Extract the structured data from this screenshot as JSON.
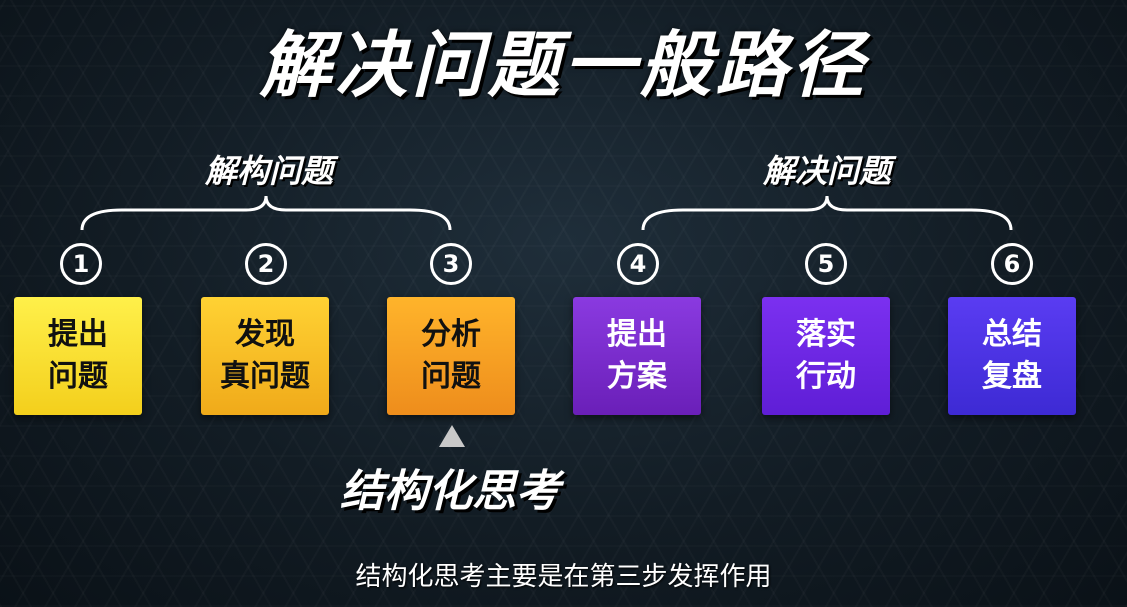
{
  "title": "解决问题一般路径",
  "groups": [
    {
      "label": "解构问题"
    },
    {
      "label": "解决问题"
    }
  ],
  "steps": [
    {
      "number": "1",
      "label": "提出\n问题",
      "color": "#f7e02c"
    },
    {
      "number": "2",
      "label": "发现\n真问题",
      "color": "#f8c02a"
    },
    {
      "number": "3",
      "label": "分析\n问题",
      "color": "#f5a223"
    },
    {
      "number": "4",
      "label": "提出\n方案",
      "color": "#7a2ccc"
    },
    {
      "number": "5",
      "label": "落实\n行动",
      "color": "#6d27e4"
    },
    {
      "number": "6",
      "label": "总结\n复盘",
      "color": "#4c33e3"
    }
  ],
  "highlight": {
    "label": "结构化思考"
  },
  "subtitle": "结构化思考主要是在第三步发挥作用"
}
